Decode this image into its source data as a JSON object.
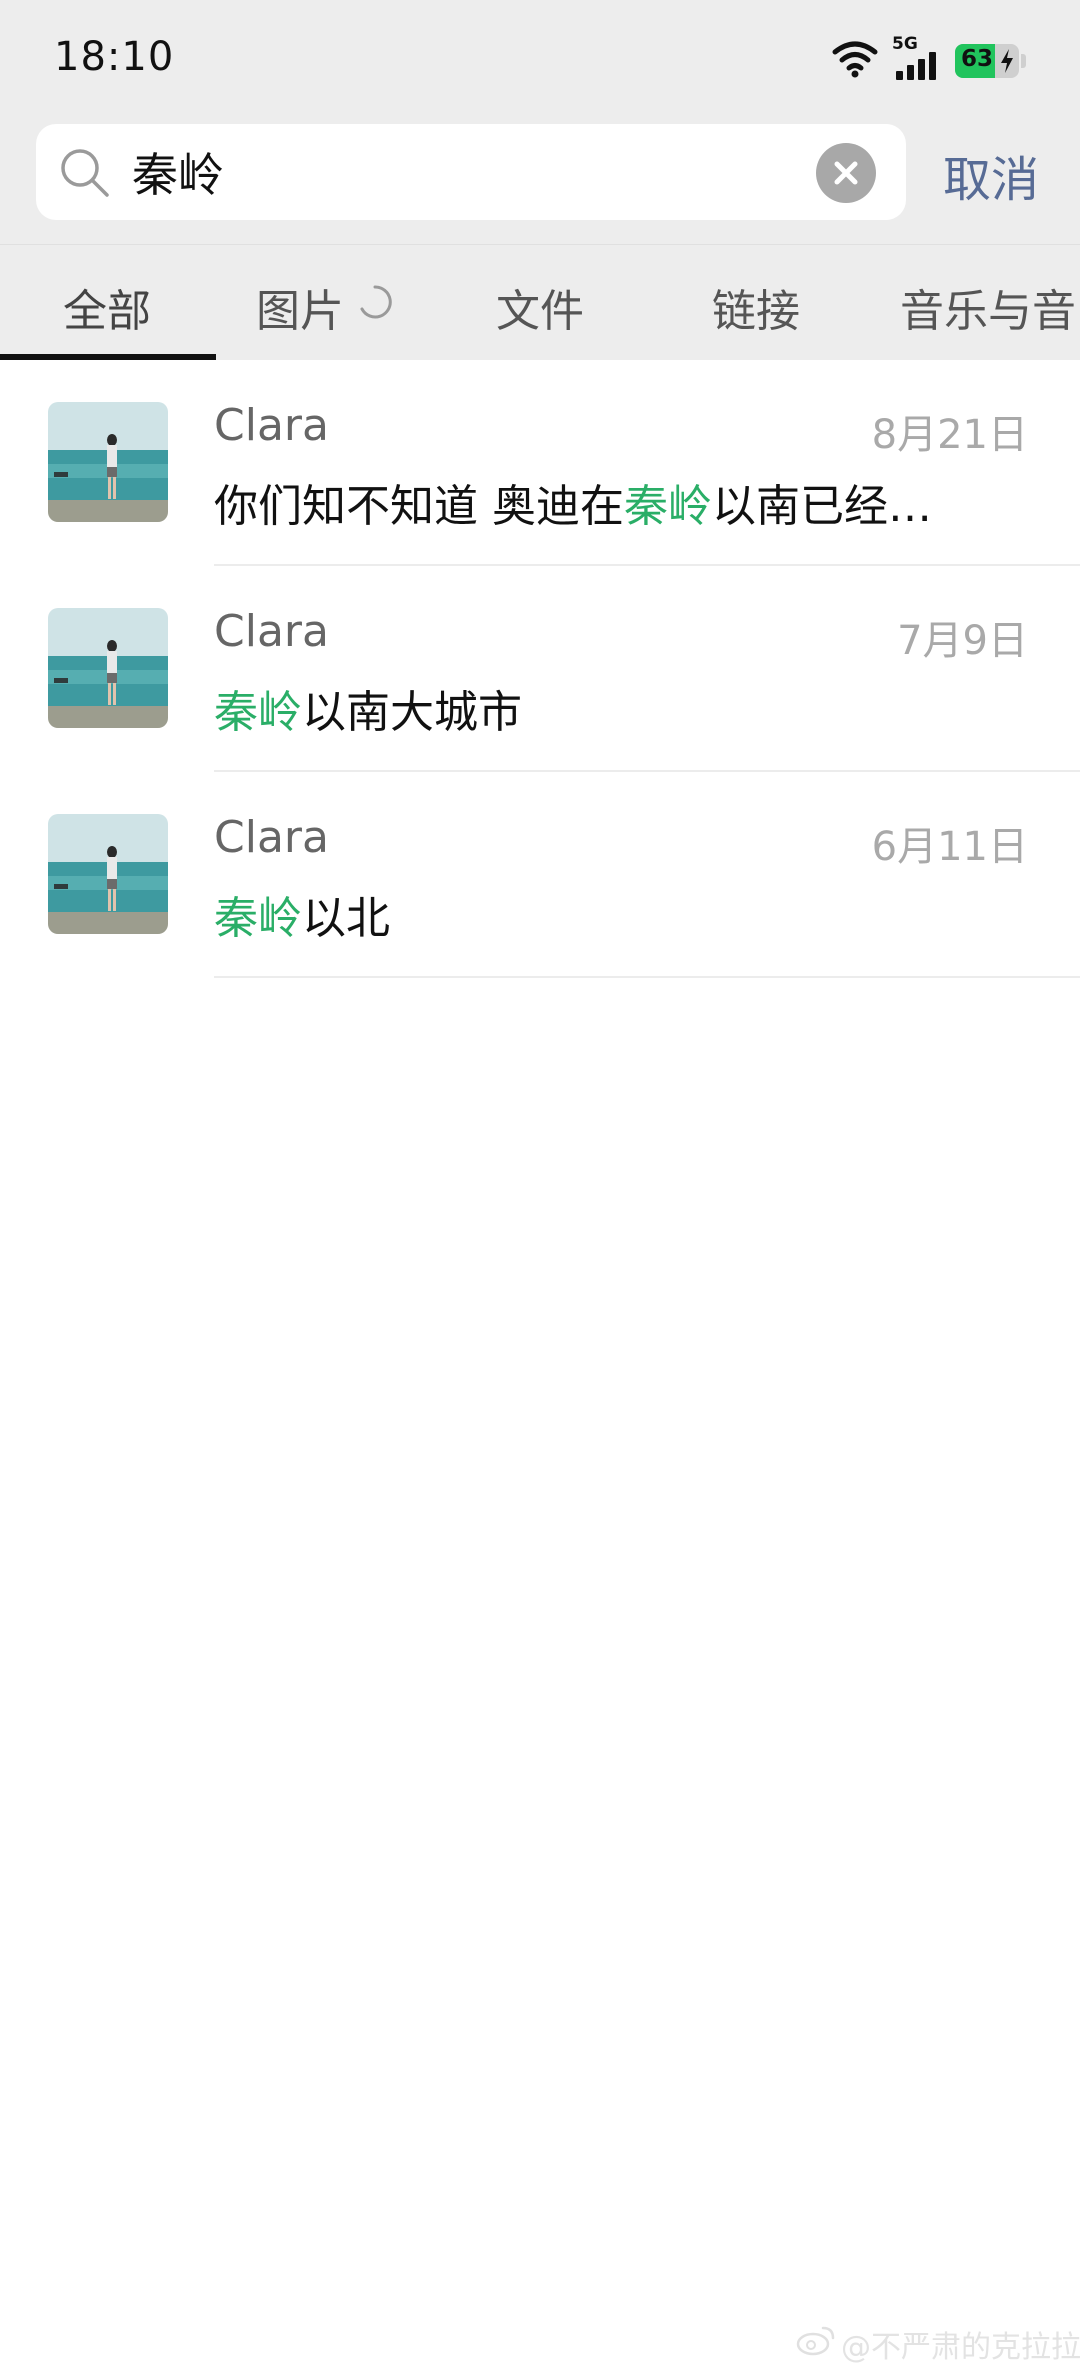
{
  "status_bar": {
    "time": "18:10",
    "network": "5G",
    "battery_level": "63",
    "battery_fraction": 0.63,
    "battery_color": "#21c45d"
  },
  "search": {
    "query": "秦岭",
    "cancel_label": "取消"
  },
  "tabs": [
    {
      "label": "全部",
      "active": true
    },
    {
      "label": "图片",
      "active": false,
      "loading": true
    },
    {
      "label": "文件",
      "active": false
    },
    {
      "label": "链接",
      "active": false
    },
    {
      "label": "音乐与音",
      "active": false
    }
  ],
  "highlight_color": "#2aae67",
  "results": [
    {
      "name": "Clara",
      "date": "8月21日",
      "snippet": {
        "before": "你们知不知道 奥迪在",
        "match": "秦岭",
        "after": "以南已经…"
      }
    },
    {
      "name": "Clara",
      "date": "7月9日",
      "snippet": {
        "before": "",
        "match": "秦岭",
        "after": "以南大城市"
      }
    },
    {
      "name": "Clara",
      "date": "6月11日",
      "snippet": {
        "before": "",
        "match": "秦岭",
        "after": "以北"
      }
    }
  ],
  "watermark": {
    "icon": "weibo-icon",
    "text": "@不严肃的克拉拉"
  }
}
